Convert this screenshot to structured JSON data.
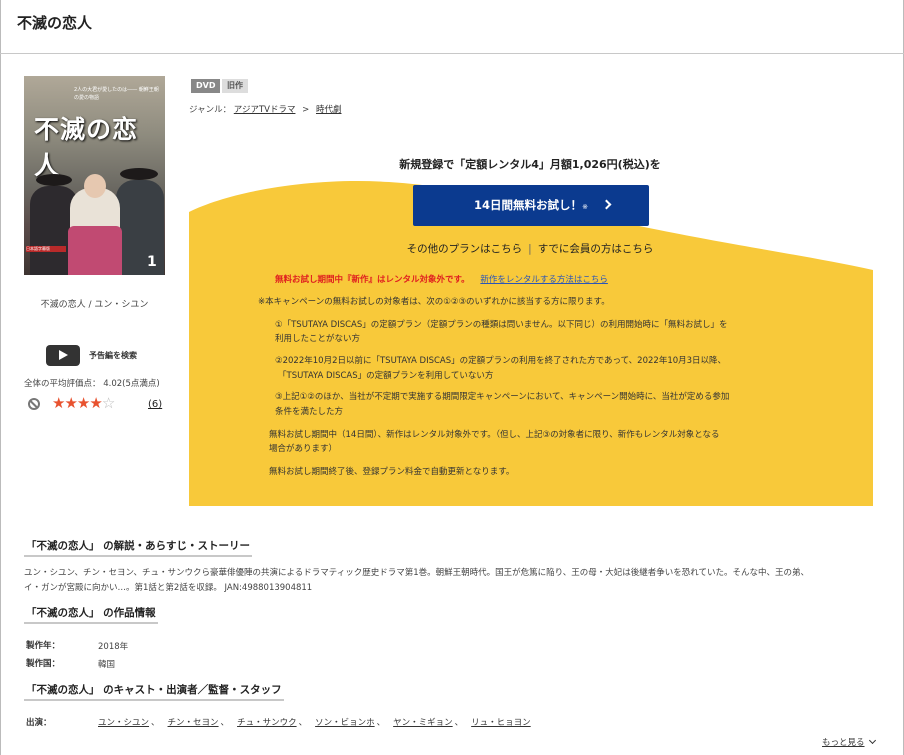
{
  "page": {
    "title": "不滅の恋人"
  },
  "cover": {
    "logo_text": "不滅の恋人",
    "tagline": "2人の大君が愛したのは―― 朝鮮王朝の愛の物語",
    "volume": "1",
    "band": "日本語字幕版",
    "caption": "不滅の恋人 / ユン・シユン"
  },
  "trailer": {
    "label": "予告編を検索"
  },
  "rating": {
    "text": "全体の平均評価点： 4.02(5点満点)",
    "stars_filled": 4,
    "stars_total": 5,
    "count": "(6)"
  },
  "tags": {
    "format": "DVD",
    "status": "旧作"
  },
  "genre": {
    "label": "ジャンル：",
    "level1": "アジアTVドラマ",
    "separator": ">",
    "level2": "時代劇"
  },
  "promo": {
    "title": "新規登録で「定額レンタル4」月額1,026円(税込)を",
    "button_label": "14日間無料お試し！",
    "button_note": "※",
    "other_plans": "その他のプランはこちら",
    "divider": "|",
    "member_link": "すでに会員の方はこちら",
    "warning": "無料お試し期間中『新作』はレンタル対象外です。",
    "warning_link": "新作をレンタルする方法はこちら",
    "note_intro": "※本キャンペーンの無料お試しの対象者は、次の①②③のいずれかに該当する方に限ります。",
    "cond1_a": "①「TSUTAYA DISCAS」の定額プラン（定額プランの種類は問いません。以下同じ）の利用開始時に「無料お試し」を",
    "cond1_b": "利用したことがない方",
    "cond2_a": "②2022年10月2日以前に「TSUTAYA DISCAS」の定額プランの利用を終了された方であって、2022年10月3日以降、",
    "cond2_b": "「TSUTAYA DISCAS」の定額プランを利用していない方",
    "cond3_a": "③上記①②のほか、当社が不定期で実施する期間限定キャンペーンにおいて、キャンペーン開始時に、当社が定める参加",
    "cond3_b": "条件を満たした方",
    "trial_a": "無料お試し期間中（14日間）、新作はレンタル対象外です。（但し、上記③の対象者に限り、新作もレンタル対象となる",
    "trial_b": "場合があります）",
    "renewal": "無料お試し期間終了後、登録プラン料金で自動更新となります。",
    "bg_color": "#f8c93a",
    "button_color": "#0b3a8f"
  },
  "story": {
    "heading": "「不滅の恋人」 の解説・あらすじ・ストーリー",
    "line1": "ユン・シユン、チン・セヨン、チュ・サンウクら豪華俳優陣の共演によるドラマティック歴史ドラマ第1巻。朝鮮王朝時代。国王が危篤に陥り、王の母・大妃は後継者争いを恐れていた。そんな中、王の弟、",
    "line2": "イ・ガンが宮殿に向かい…。第1話と第2話を収録。 JAN:4988013904811"
  },
  "info": {
    "heading": "「不滅の恋人」 の作品情報",
    "year_label": "製作年：",
    "year": "2018年",
    "country_label": "製作国：",
    "country": "韓国"
  },
  "cast": {
    "heading": "「不滅の恋人」 のキャスト・出演者／監督・スタッフ",
    "label": "出演：",
    "names": [
      "ユン・シユン",
      "チン・セヨン",
      "チュ・サンウク",
      "ソン・ビョンホ",
      "ヤン・ミギョン",
      "リュ・ヒョヨン"
    ],
    "separator": "、",
    "more": "もっと見る"
  }
}
